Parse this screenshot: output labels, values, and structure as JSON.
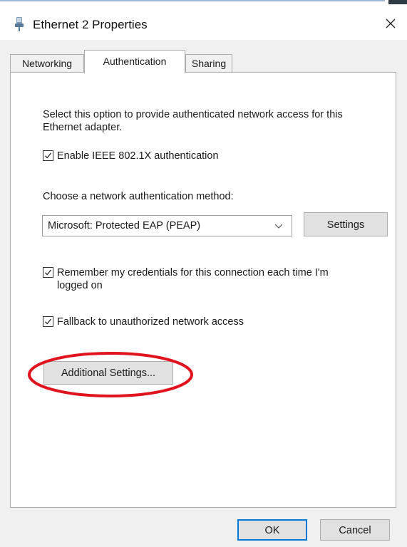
{
  "window": {
    "title": "Ethernet 2 Properties",
    "title_icon": "network-adapter-icon",
    "close_icon": "close-icon"
  },
  "tabs": [
    {
      "label": "Networking",
      "active": false
    },
    {
      "label": "Authentication",
      "active": true
    },
    {
      "label": "Sharing",
      "active": false
    }
  ],
  "authentication": {
    "description": "Select this option to provide authenticated network access for this Ethernet adapter.",
    "enable_8021x": {
      "label": "Enable IEEE 802.1X authentication",
      "checked": true
    },
    "method_label": "Choose a network authentication method:",
    "method_select": {
      "value": "Microsoft: Protected EAP (PEAP)"
    },
    "settings_button": "Settings",
    "remember_credentials": {
      "label": "Remember my credentials for this connection each time I'm logged on",
      "checked": true
    },
    "fallback": {
      "label": "Fallback to unauthorized network access",
      "checked": true
    },
    "additional_settings_button": "Additional Settings..."
  },
  "footer": {
    "ok_label": "OK",
    "cancel_label": "Cancel"
  },
  "colors": {
    "annotation": "#e0141e",
    "focus": "#0078d7"
  }
}
